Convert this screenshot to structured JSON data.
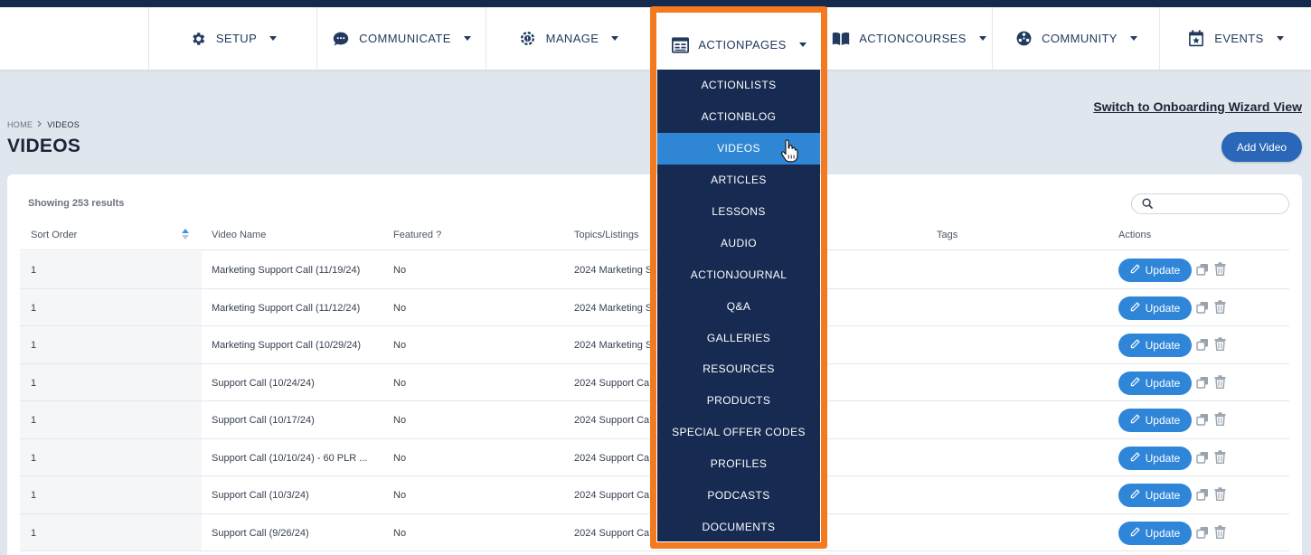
{
  "nav": {
    "items": [
      {
        "label": "SETUP",
        "icon": "gear-icon"
      },
      {
        "label": "COMMUNICATE",
        "icon": "chat-bubble-icon"
      },
      {
        "label": "MANAGE",
        "icon": "cog-alert-icon"
      },
      {
        "label": "ACTIONPAGES",
        "icon": "newspaper-icon"
      },
      {
        "label": "ACTIONCOURSES",
        "icon": "book-open-icon"
      },
      {
        "label": "COMMUNITY",
        "icon": "community-circle-icon"
      },
      {
        "label": "EVENTS",
        "icon": "calendar-star-icon"
      }
    ]
  },
  "dropdown": {
    "items": [
      "ACTIONLISTS",
      "ACTIONBLOG",
      "VIDEOS",
      "ARTICLES",
      "LESSONS",
      "AUDIO",
      "ACTIONJOURNAL",
      "Q&A",
      "GALLERIES",
      "RESOURCES",
      "PRODUCTS",
      "SPECIAL OFFER CODES",
      "PROFILES",
      "PODCASTS",
      "DOCUMENTS"
    ],
    "active": "VIDEOS"
  },
  "breadcrumb": {
    "home": "HOME",
    "current": "VIDEOS"
  },
  "page": {
    "title": "VIDEOS",
    "wizard_link": "Switch to Onboarding Wizard View",
    "add_button": "Add Video"
  },
  "table": {
    "showing": "Showing 253 results",
    "columns": [
      "Sort Order",
      "Video Name",
      "Featured ?",
      "Topics/Listings",
      "Tags",
      "Actions"
    ],
    "update_label": "Update",
    "rows": [
      {
        "sort": "1",
        "name": "Marketing Support Call (11/19/24)",
        "featured": "No",
        "topics": "2024 Marketing S"
      },
      {
        "sort": "1",
        "name": "Marketing Support Call (11/12/24)",
        "featured": "No",
        "topics": "2024 Marketing S"
      },
      {
        "sort": "1",
        "name": "Marketing Support Call (10/29/24)",
        "featured": "No",
        "topics": "2024 Marketing S"
      },
      {
        "sort": "1",
        "name": "Support Call (10/24/24)",
        "featured": "No",
        "topics": "2024 Support Ca"
      },
      {
        "sort": "1",
        "name": "Support Call (10/17/24)",
        "featured": "No",
        "topics": "2024 Support Ca"
      },
      {
        "sort": "1",
        "name": "Support Call (10/10/24) - 60 PLR ...",
        "featured": "No",
        "topics": "2024 Support Ca"
      },
      {
        "sort": "1",
        "name": "Support Call (10/3/24)",
        "featured": "No",
        "topics": "2024 Support Ca"
      },
      {
        "sort": "1",
        "name": "Support Call (9/26/24)",
        "featured": "No",
        "topics": "2024 Support Ca"
      }
    ]
  },
  "colors": {
    "navy": "#172a52",
    "accent_blue": "#2e86d4",
    "highlight_orange": "#f47a1f"
  }
}
